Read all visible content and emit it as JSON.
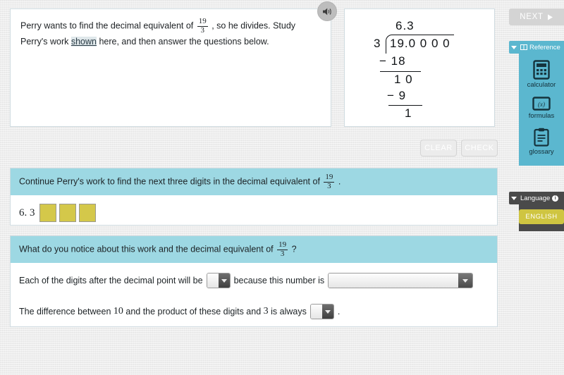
{
  "colors": {
    "question_header": "#9dd8e3",
    "reference_panel": "#5bb7cf",
    "language_panel": "#4a4a4a",
    "answer_box": "#d4c84a",
    "language_button": "#cfc541",
    "page_background": "#ededed"
  },
  "prompt": {
    "part1": "Perry wants to find the decimal equivalent of ",
    "fraction": {
      "numerator": "19",
      "denominator": "3"
    },
    "part2": " , so he divides. Study Perry's work ",
    "link": "shown",
    "part3": " here, and then answer the questions below.",
    "audio_icon": "speaker-icon"
  },
  "division_work": {
    "quotient": "6.3",
    "divisor": "3",
    "dividend": "19.0 0 0 0",
    "step1_subtract": "− 18",
    "step1_remainder": "1 0",
    "step2_subtract": "−  9",
    "step2_remainder": "1"
  },
  "actions": {
    "clear_label": "CLEAR",
    "check_label": "CHECK"
  },
  "question1": {
    "prompt_part1": "Continue Perry's work to find the next three digits in the decimal equivalent of ",
    "fraction": {
      "numerator": "19",
      "denominator": "3"
    },
    "prompt_part2": " .",
    "answer_prefix": "6. 3",
    "boxes": [
      "",
      "",
      ""
    ]
  },
  "question2": {
    "prompt_part1": "What do you notice about this work and the decimal equivalent of ",
    "fraction": {
      "numerator": "19",
      "denominator": "3"
    },
    "prompt_part2": " ?",
    "sentence1": {
      "text1": "Each of the digits after the decimal point will be",
      "dropdown1_value": "",
      "text2": "because this number is",
      "dropdown2_value": ""
    },
    "sentence2": {
      "text1": "The difference between ",
      "number1": "10",
      "text2": " and the product of these digits and ",
      "number2": "3",
      "text3": " is always",
      "dropdown_value": "",
      "text4": "."
    }
  },
  "rail": {
    "next_label": "NEXT",
    "next_icon": "play-triangle-icon",
    "reference": {
      "title": "Reference",
      "header_icon": "book-icon",
      "collapse_icon": "caret-down-icon",
      "items": [
        {
          "label": "calculator",
          "icon": "calculator-icon"
        },
        {
          "label": "formulas",
          "icon": "formulas-icon"
        },
        {
          "label": "glossary",
          "icon": "clipboard-icon"
        }
      ]
    },
    "language": {
      "title": "Language",
      "info_icon": "info-icon",
      "info_glyph": "i",
      "collapse_icon": "caret-down-icon",
      "button_label": "ENGLISH"
    }
  }
}
